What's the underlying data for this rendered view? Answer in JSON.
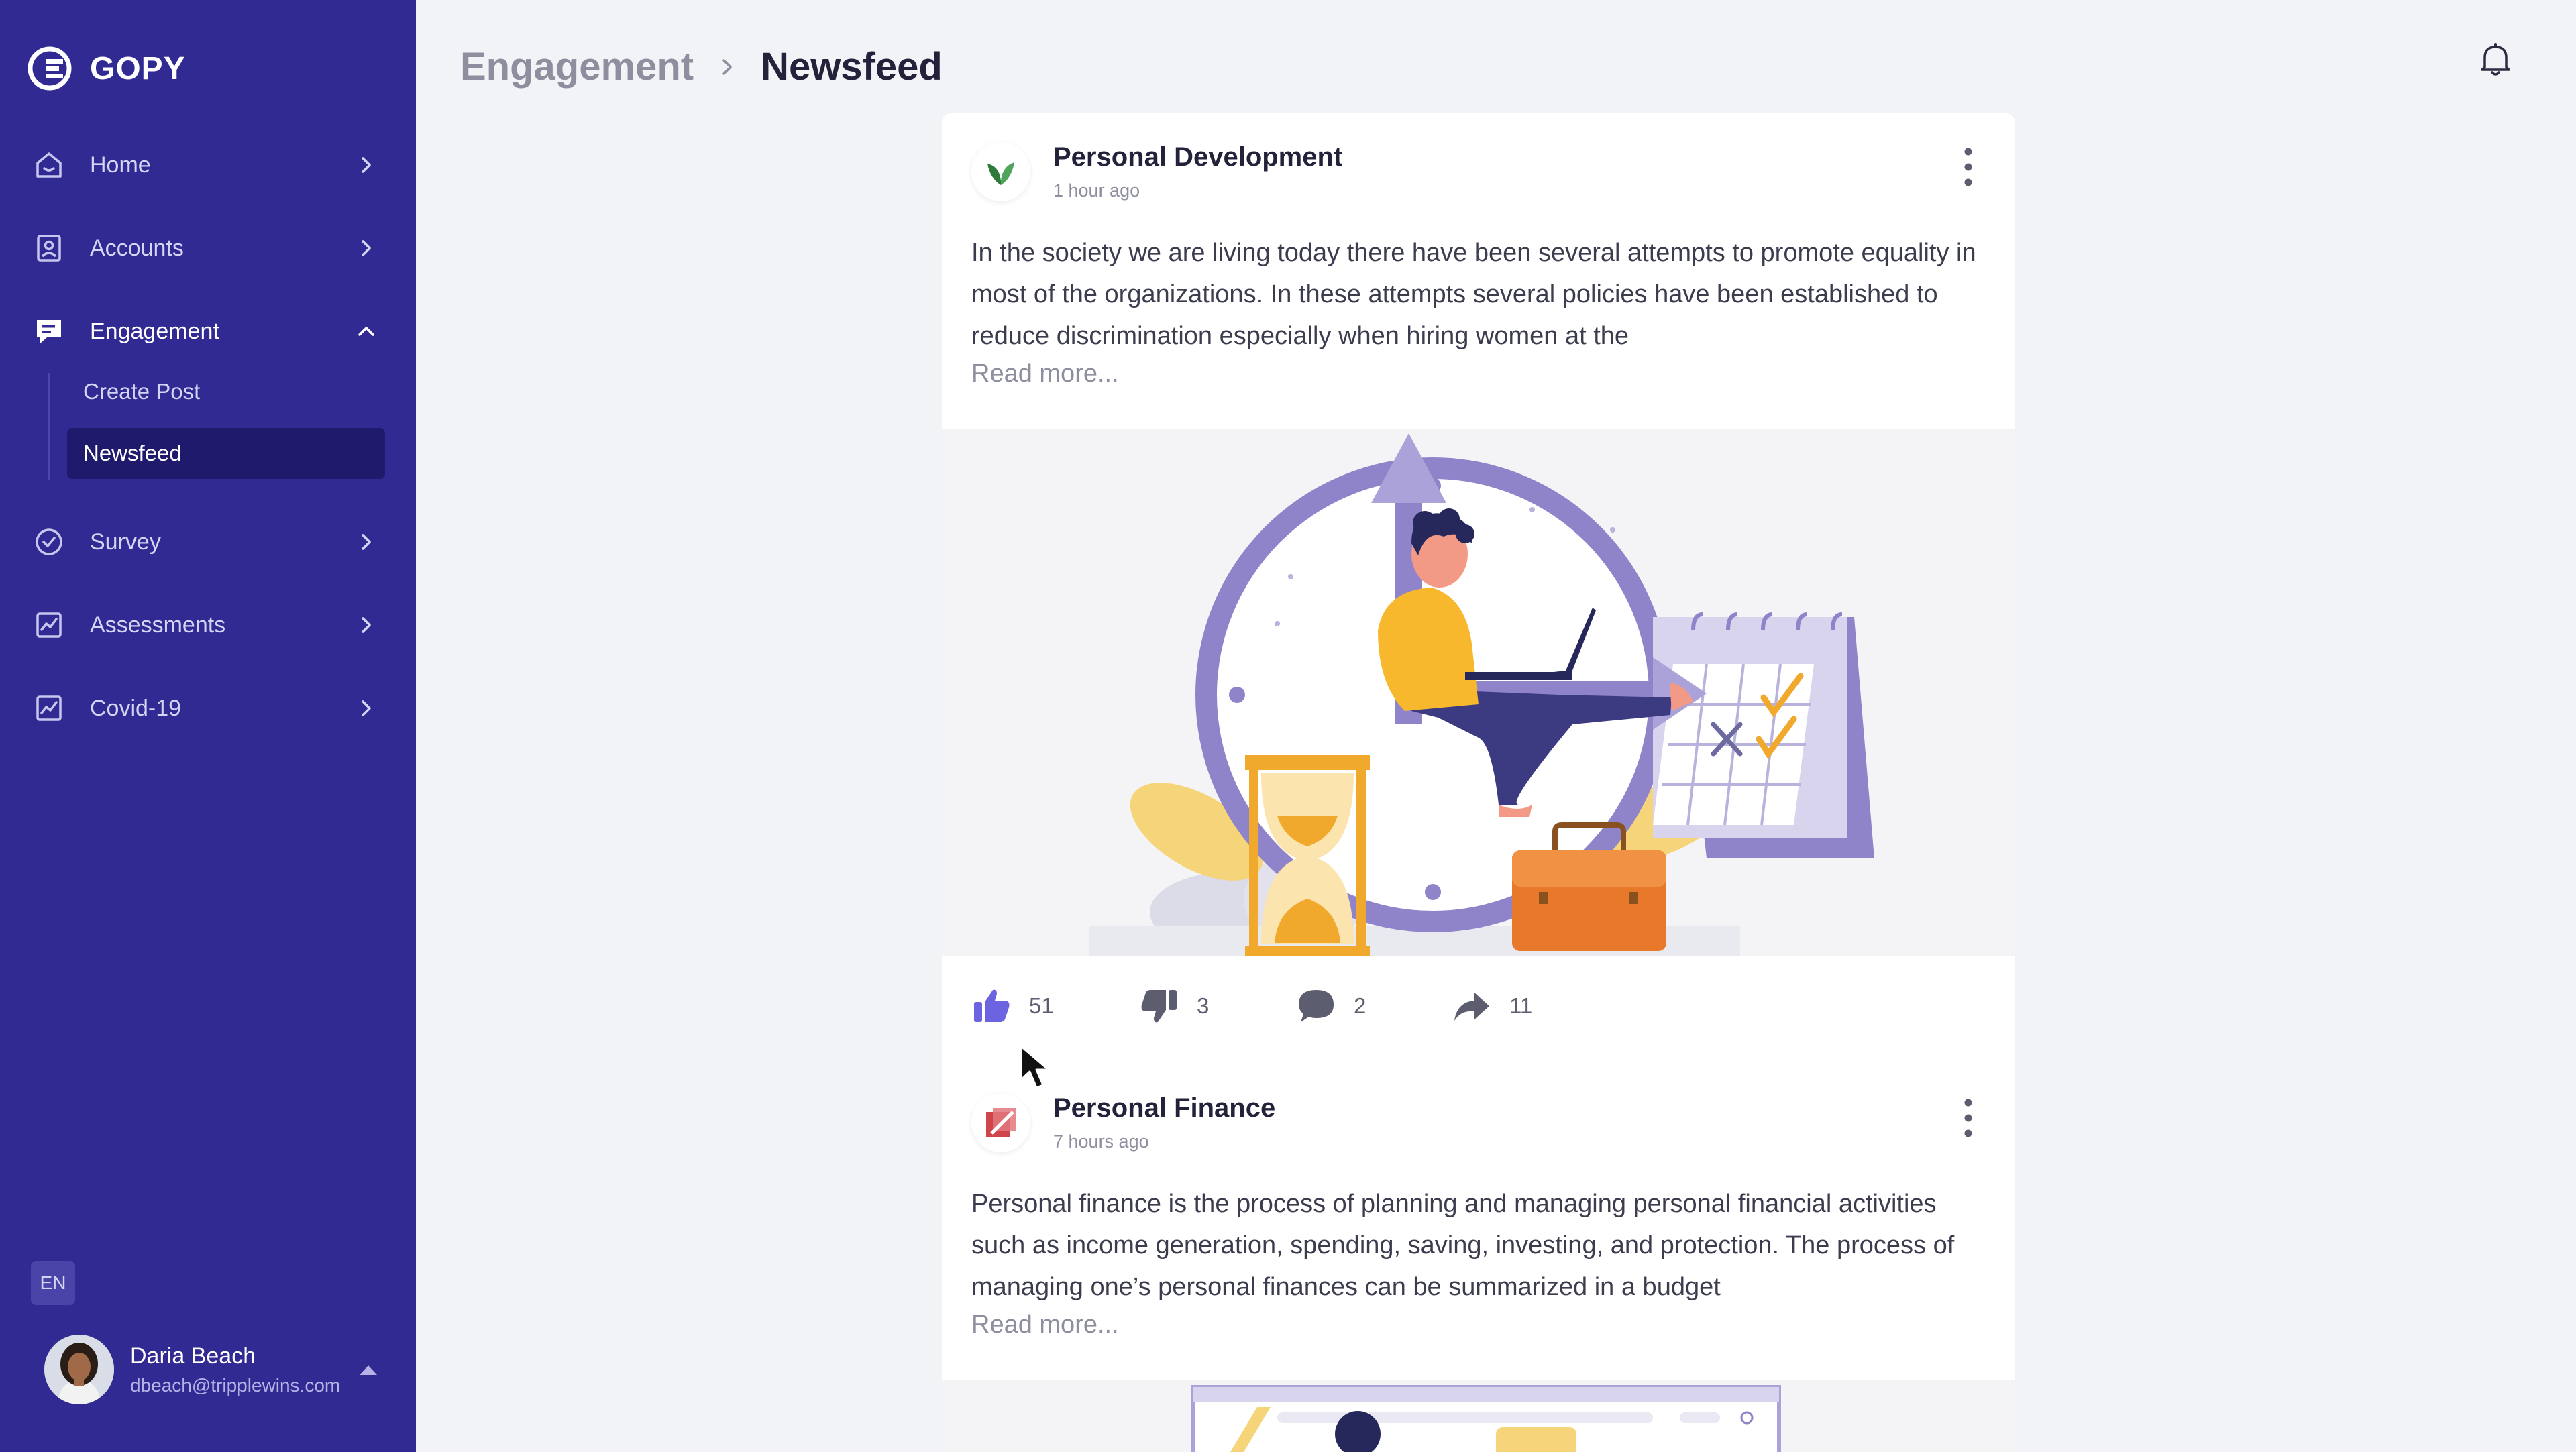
{
  "app": {
    "brand": "GOPY",
    "accent": "#312a93",
    "accent_dark": "#1f1a6b",
    "like_color": "#6c63e0"
  },
  "sidebar": {
    "items": [
      {
        "label": "Home",
        "icon": "home-icon"
      },
      {
        "label": "Accounts",
        "icon": "user-card-icon"
      },
      {
        "label": "Engagement",
        "icon": "chat-icon",
        "expanded": true,
        "children": [
          {
            "label": "Create Post"
          },
          {
            "label": "Newsfeed",
            "selected": true
          }
        ]
      },
      {
        "label": "Survey",
        "icon": "check-circle-icon"
      },
      {
        "label": "Assessments",
        "icon": "chart-icon"
      },
      {
        "label": "Covid-19",
        "icon": "chart-icon"
      }
    ],
    "language": "EN",
    "user": {
      "name": "Daria Beach",
      "email": "dbeach@tripplewins.com"
    }
  },
  "header": {
    "breadcrumb_parent": "Engagement",
    "breadcrumb_current": "Newsfeed",
    "bell_icon": "bell-icon"
  },
  "posts": [
    {
      "title": "Personal Development",
      "time": "1 hour ago",
      "body": "In the society we are living today there have been several attempts to promote equality in most of the organizations. In these attempts several policies have been established to reduce discrimination especially when hiring women at the",
      "read_more": "Read more...",
      "likes": "51",
      "dislikes": "3",
      "comments": "2",
      "shares": "11"
    },
    {
      "title": "Personal Finance",
      "time": "7 hours ago",
      "body": "Personal finance is the process of planning and managing personal financial activities such as income generation, spending, saving, investing, and protection. The process of managing one’s personal finances can be summarized in a budget",
      "read_more": "Read more..."
    }
  ]
}
